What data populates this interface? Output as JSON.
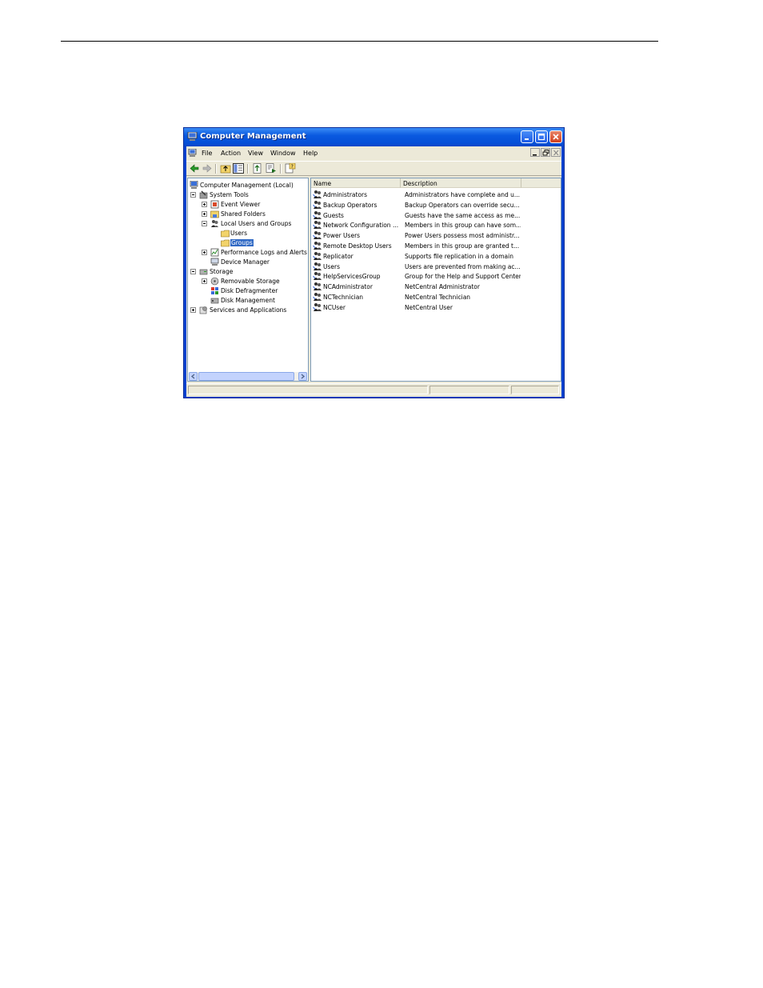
{
  "window": {
    "title": "Computer Management"
  },
  "menubar": {
    "items": [
      "File",
      "Action",
      "View",
      "Window",
      "Help"
    ]
  },
  "tree": {
    "items": [
      {
        "label": "Computer Management (Local)",
        "icon": "computer-icon"
      },
      {
        "label": "System Tools",
        "icon": "tools-icon"
      },
      {
        "label": "Event Viewer",
        "icon": "event-viewer-icon"
      },
      {
        "label": "Shared Folders",
        "icon": "shared-folder-icon"
      },
      {
        "label": "Local Users and Groups",
        "icon": "users-groups-icon"
      },
      {
        "label": "Users",
        "icon": "folder-icon"
      },
      {
        "label": "Groups",
        "icon": "folder-open-icon",
        "selected": true
      },
      {
        "label": "Performance Logs and Alerts",
        "icon": "performance-icon"
      },
      {
        "label": "Device Manager",
        "icon": "device-manager-icon"
      },
      {
        "label": "Storage",
        "icon": "storage-icon"
      },
      {
        "label": "Removable Storage",
        "icon": "removable-storage-icon"
      },
      {
        "label": "Disk Defragmenter",
        "icon": "defrag-icon"
      },
      {
        "label": "Disk Management",
        "icon": "disk-management-icon"
      },
      {
        "label": "Services and Applications",
        "icon": "services-icon"
      }
    ]
  },
  "list": {
    "columns": [
      "Name",
      "Description"
    ],
    "rows": [
      {
        "name": "Administrators",
        "description": "Administrators have complete and u..."
      },
      {
        "name": "Backup Operators",
        "description": "Backup Operators can override secu..."
      },
      {
        "name": "Guests",
        "description": "Guests have the same access as me..."
      },
      {
        "name": "Network Configuration ...",
        "description": "Members in this group can have som..."
      },
      {
        "name": "Power Users",
        "description": "Power Users possess most administr..."
      },
      {
        "name": "Remote Desktop Users",
        "description": "Members in this group are granted t..."
      },
      {
        "name": "Replicator",
        "description": "Supports file replication in a domain"
      },
      {
        "name": "Users",
        "description": "Users are prevented from making ac..."
      },
      {
        "name": "HelpServicesGroup",
        "description": "Group for the Help and Support Center"
      },
      {
        "name": "NCAdministrator",
        "description": "NetCentral Administrator"
      },
      {
        "name": "NCTechnician",
        "description": "NetCentral Technician"
      },
      {
        "name": "NCUser",
        "description": "NetCentral User"
      }
    ]
  },
  "colors": {
    "titlebar": "#0a5ae0",
    "selection": "#316ac5",
    "close": "#d2401e"
  }
}
